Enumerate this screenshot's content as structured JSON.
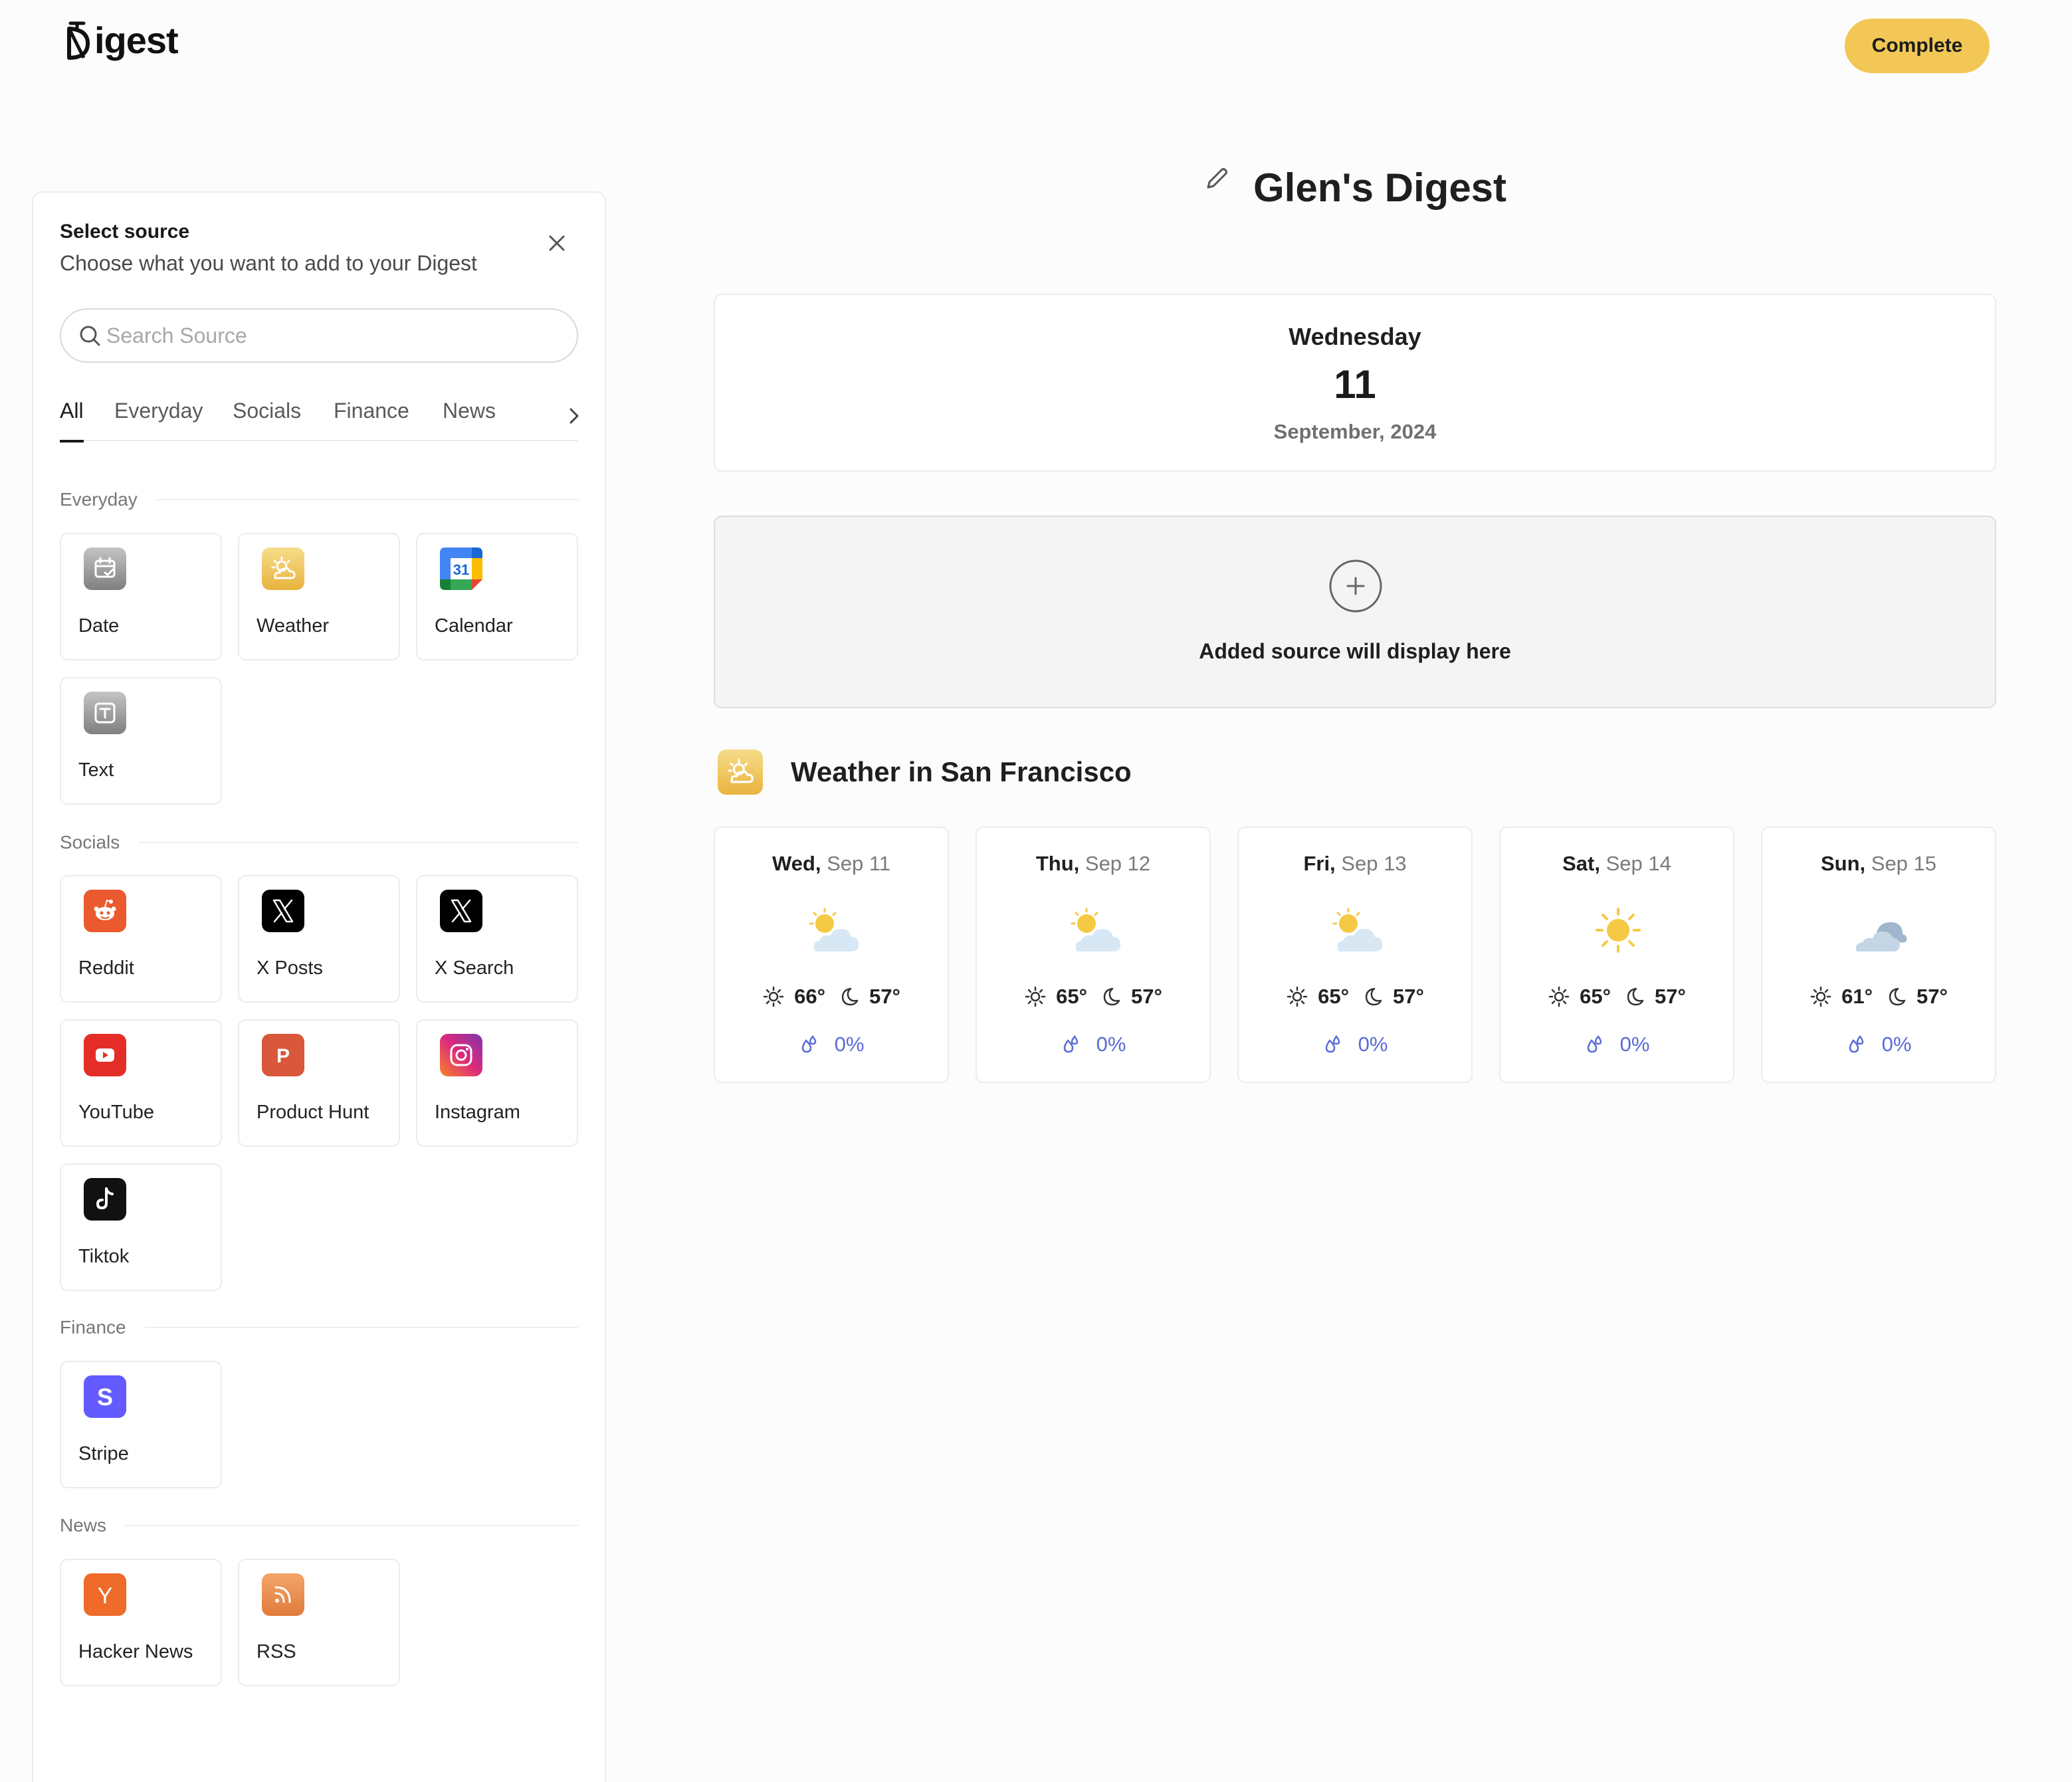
{
  "header": {
    "logo_text": "igest",
    "complete_label": "Complete"
  },
  "sidebar": {
    "title": "Select source",
    "subtitle": "Choose what you want to add to your Digest",
    "search_placeholder": "Search Source",
    "tabs": [
      "All",
      "Everyday",
      "Socials",
      "Finance",
      "News"
    ],
    "active_tab": "All",
    "sections": {
      "everyday": {
        "label": "Everyday",
        "items": [
          "Date",
          "Weather",
          "Calendar",
          "Text"
        ]
      },
      "socials": {
        "label": "Socials",
        "items": [
          "Reddit",
          "X Posts",
          "X Search",
          "YouTube",
          "Product Hunt",
          "Instagram",
          "Tiktok"
        ]
      },
      "finance": {
        "label": "Finance",
        "items": [
          "Stripe"
        ]
      },
      "news": {
        "label": "News",
        "items": [
          "Hacker News",
          "RSS"
        ]
      }
    },
    "icon_names": {
      "Date": "calendar-check-icon",
      "Weather": "sun-cloud-icon",
      "Calendar": "google-calendar-icon",
      "Text": "text-box-icon",
      "Reddit": "reddit-icon",
      "X Posts": "x-logo-icon",
      "X Search": "x-logo-icon",
      "YouTube": "youtube-icon",
      "Product Hunt": "product-hunt-icon",
      "Instagram": "instagram-icon",
      "Tiktok": "tiktok-icon",
      "Stripe": "stripe-icon",
      "Hacker News": "hacker-news-icon",
      "RSS": "rss-icon"
    }
  },
  "main": {
    "title": "Glen's Digest",
    "date": {
      "weekday": "Wednesday",
      "day": "11",
      "month_year": "September, 2024"
    },
    "placeholder_text": "Added source will display here",
    "weather": {
      "title": "Weather in San Francisco",
      "days": [
        {
          "dow": "Wed,",
          "date": "Sep 11",
          "high": "66°",
          "low": "57°",
          "precip": "0%",
          "condition": "partly-cloudy"
        },
        {
          "dow": "Thu,",
          "date": "Sep 12",
          "high": "65°",
          "low": "57°",
          "precip": "0%",
          "condition": "partly-cloudy"
        },
        {
          "dow": "Fri,",
          "date": "Sep 13",
          "high": "65°",
          "low": "57°",
          "precip": "0%",
          "condition": "partly-cloudy"
        },
        {
          "dow": "Sat,",
          "date": "Sep 14",
          "high": "65°",
          "low": "57°",
          "precip": "0%",
          "condition": "sunny"
        },
        {
          "dow": "Sun,",
          "date": "Sep 15",
          "high": "61°",
          "low": "57°",
          "precip": "0%",
          "condition": "cloudy"
        }
      ]
    }
  },
  "colors": {
    "accent": "#f2c756",
    "precip": "#5a6bd8"
  }
}
